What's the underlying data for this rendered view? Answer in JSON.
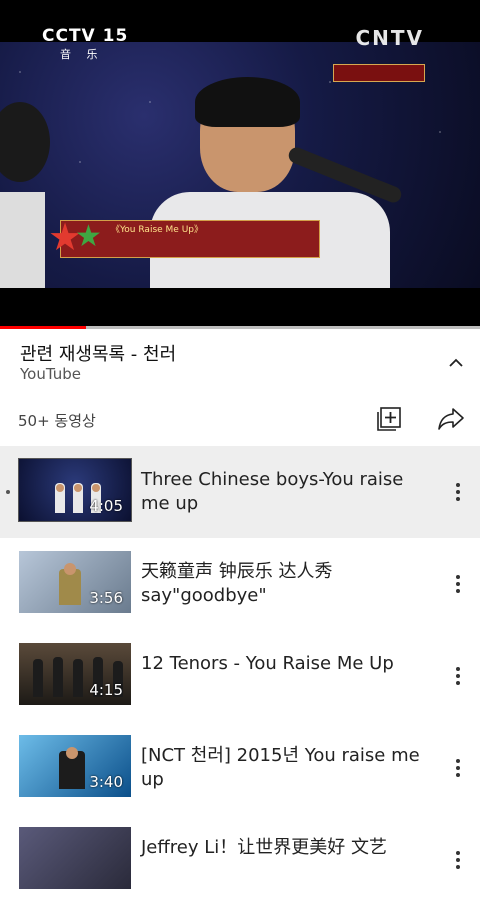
{
  "player": {
    "overlay": {
      "channel_logo": "CCTV 15",
      "channel_sub": "音 乐",
      "network_logo": "CNTV",
      "caption_line1": "《You Raise Me Up》",
      "progress_fraction": 0.18
    }
  },
  "playlist": {
    "title": "관련 재생목록 - 천러",
    "channel": "YouTube",
    "count": "50+ 동영상",
    "collapse_icon": "chevron-up-icon",
    "add_icon": "add-to-playlist-icon",
    "share_icon": "share-icon"
  },
  "items": [
    {
      "title": "Three Chinese boys-You raise me up",
      "duration": "4:05",
      "active": true
    },
    {
      "title": "天籁童声 钟辰乐 达人秀 say\"goodbye\"",
      "duration": "3:56",
      "active": false
    },
    {
      "title": "12 Tenors -  You Raise Me Up",
      "duration": "4:15",
      "active": false
    },
    {
      "title": "[NCT 천러] 2015년 You raise me up",
      "duration": "3:40",
      "active": false
    },
    {
      "title": "Jeffrey Li！让世界更美好 文艺",
      "duration": "",
      "active": false
    }
  ],
  "colors": {
    "progress": "#ff0000",
    "active_row": "#eeeeee"
  }
}
